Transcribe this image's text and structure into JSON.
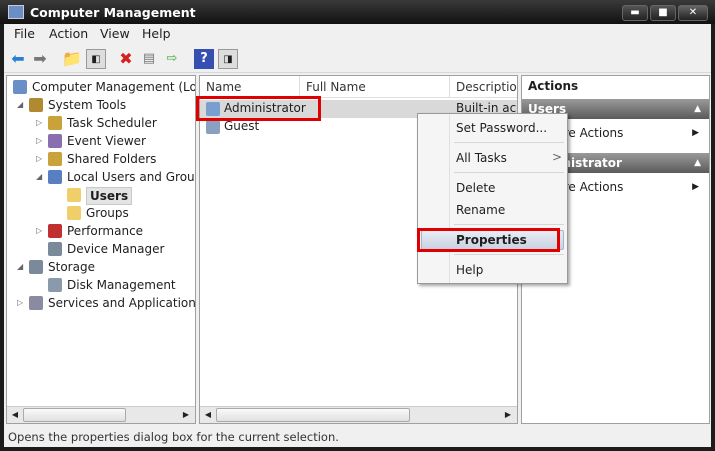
{
  "window": {
    "title": "Computer Management",
    "minimize": "▬",
    "maximize": "■",
    "close": "✕"
  },
  "menubar": [
    "File",
    "Action",
    "View",
    "Help"
  ],
  "tree": [
    {
      "label": "Computer Management (Local",
      "level": 0,
      "arrow": ""
    },
    {
      "label": "System Tools",
      "level": 0,
      "arrow": "◢"
    },
    {
      "label": "Task Scheduler",
      "level": 1,
      "arrow": "▷"
    },
    {
      "label": "Event Viewer",
      "level": 1,
      "arrow": "▷"
    },
    {
      "label": "Shared Folders",
      "level": 1,
      "arrow": "▷"
    },
    {
      "label": "Local Users and Groups",
      "level": 1,
      "arrow": "◢"
    },
    {
      "label": "Users",
      "level": 2,
      "arrow": "",
      "selected": true
    },
    {
      "label": "Groups",
      "level": 2,
      "arrow": ""
    },
    {
      "label": "Performance",
      "level": 1,
      "arrow": "▷"
    },
    {
      "label": "Device Manager",
      "level": 1,
      "arrow": ""
    },
    {
      "label": "Storage",
      "level": 0,
      "arrow": "◢"
    },
    {
      "label": "Disk Management",
      "level": 1,
      "arrow": ""
    },
    {
      "label": "Services and Applications",
      "level": 0,
      "arrow": "▷"
    }
  ],
  "list": {
    "columns": [
      "Name",
      "Full Name",
      "Description"
    ],
    "rows": [
      {
        "name": "Administrator",
        "full_name": "",
        "description": "Built-in acco"
      },
      {
        "name": "Guest",
        "full_name": "",
        "description": ""
      }
    ]
  },
  "actions": {
    "title": "Actions",
    "sections": [
      {
        "header": "Users",
        "item": "More Actions"
      },
      {
        "header": "Administrator",
        "item": "More Actions"
      }
    ]
  },
  "context_menu": {
    "set_password": "Set Password...",
    "all_tasks": "All Tasks",
    "submenu_arrow": ">",
    "delete": "Delete",
    "rename": "Rename",
    "properties": "Properties",
    "help": "Help"
  },
  "status": "Opens the properties dialog box for the current selection.",
  "colors": {
    "highlight": "#e00000",
    "selection": "#d9d9d9"
  }
}
